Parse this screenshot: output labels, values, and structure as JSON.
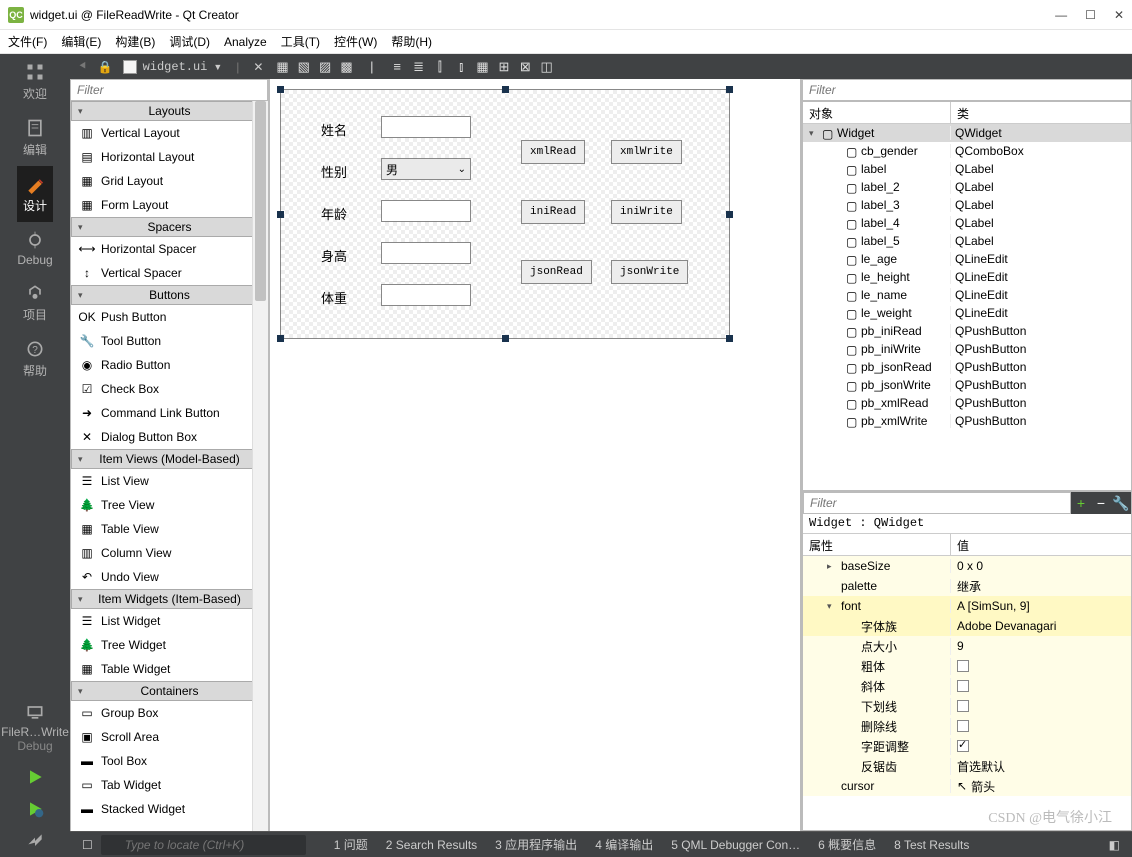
{
  "window": {
    "title": "widget.ui @ FileReadWrite - Qt Creator",
    "logo_text": "QC"
  },
  "menubar": [
    "文件(F)",
    "编辑(E)",
    "构建(B)",
    "调试(D)",
    "Analyze",
    "工具(T)",
    "控件(W)",
    "帮助(H)"
  ],
  "leftbar": {
    "items": [
      {
        "label": "欢迎",
        "active": false
      },
      {
        "label": "编辑",
        "active": false
      },
      {
        "label": "设计",
        "active": true
      },
      {
        "label": "Debug",
        "active": false
      },
      {
        "label": "项目",
        "active": false
      },
      {
        "label": "帮助",
        "active": false
      }
    ],
    "kit_label": "FileR…Write",
    "debug_label": "Debug"
  },
  "filetab": {
    "doc_name": "widget.ui"
  },
  "widgetbox": {
    "filter_placeholder": "Filter",
    "groups": [
      {
        "name": "Layouts",
        "items": [
          "Vertical Layout",
          "Horizontal Layout",
          "Grid Layout",
          "Form Layout"
        ]
      },
      {
        "name": "Spacers",
        "items": [
          "Horizontal Spacer",
          "Vertical Spacer"
        ]
      },
      {
        "name": "Buttons",
        "items": [
          "Push Button",
          "Tool Button",
          "Radio Button",
          "Check Box",
          "Command Link Button",
          "Dialog Button Box"
        ]
      },
      {
        "name": "Item Views (Model-Based)",
        "items": [
          "List View",
          "Tree View",
          "Table View",
          "Column View",
          "Undo View"
        ]
      },
      {
        "name": "Item Widgets (Item-Based)",
        "items": [
          "List Widget",
          "Tree Widget",
          "Table Widget"
        ]
      },
      {
        "name": "Containers",
        "items": [
          "Group Box",
          "Scroll Area",
          "Tool Box",
          "Tab Widget",
          "Stacked Widget"
        ]
      }
    ]
  },
  "form": {
    "labels": {
      "name": "姓名",
      "gender": "性别",
      "age": "年龄",
      "height": "身高",
      "weight": "体重"
    },
    "combo_value": "男",
    "buttons": {
      "xmlRead": "xmlRead",
      "xmlWrite": "xmlWrite",
      "iniRead": "iniRead",
      "iniWrite": "iniWrite",
      "jsonRead": "jsonRead",
      "jsonWrite": "jsonWrite"
    }
  },
  "object_tree": {
    "filter_placeholder": "Filter",
    "col_object": "对象",
    "col_class": "类",
    "rows": [
      {
        "indent": 0,
        "name": "Widget",
        "class": "QWidget",
        "expand": "▾",
        "top": true
      },
      {
        "indent": 1,
        "name": "cb_gender",
        "class": "QComboBox"
      },
      {
        "indent": 1,
        "name": "label",
        "class": "QLabel"
      },
      {
        "indent": 1,
        "name": "label_2",
        "class": "QLabel"
      },
      {
        "indent": 1,
        "name": "label_3",
        "class": "QLabel"
      },
      {
        "indent": 1,
        "name": "label_4",
        "class": "QLabel"
      },
      {
        "indent": 1,
        "name": "label_5",
        "class": "QLabel"
      },
      {
        "indent": 1,
        "name": "le_age",
        "class": "QLineEdit"
      },
      {
        "indent": 1,
        "name": "le_height",
        "class": "QLineEdit"
      },
      {
        "indent": 1,
        "name": "le_name",
        "class": "QLineEdit"
      },
      {
        "indent": 1,
        "name": "le_weight",
        "class": "QLineEdit"
      },
      {
        "indent": 1,
        "name": "pb_iniRead",
        "class": "QPushButton"
      },
      {
        "indent": 1,
        "name": "pb_iniWrite",
        "class": "QPushButton"
      },
      {
        "indent": 1,
        "name": "pb_jsonRead",
        "class": "QPushButton"
      },
      {
        "indent": 1,
        "name": "pb_jsonWrite",
        "class": "QPushButton"
      },
      {
        "indent": 1,
        "name": "pb_xmlRead",
        "class": "QPushButton"
      },
      {
        "indent": 1,
        "name": "pb_xmlWrite",
        "class": "QPushButton"
      }
    ]
  },
  "property_editor": {
    "filter_placeholder": "Filter",
    "breadcrumb": "Widget : QWidget",
    "col_name": "属性",
    "col_value": "值",
    "rows": [
      {
        "name": "baseSize",
        "value": "0 x 0",
        "indent": 1,
        "expand": "▸"
      },
      {
        "name": "palette",
        "value": "继承",
        "indent": 1
      },
      {
        "name": "font",
        "value": "A  [SimSun, 9]",
        "indent": 1,
        "expand": "▾",
        "changed": true
      },
      {
        "name": "字体族",
        "value": "Adobe Devanagari",
        "indent": 2,
        "changed": true
      },
      {
        "name": "点大小",
        "value": "9",
        "indent": 2
      },
      {
        "name": "粗体",
        "value_check": false,
        "indent": 2
      },
      {
        "name": "斜体",
        "value_check": false,
        "indent": 2
      },
      {
        "name": "下划线",
        "value_check": false,
        "indent": 2
      },
      {
        "name": "删除线",
        "value_check": false,
        "indent": 2
      },
      {
        "name": "字距调整",
        "value_check": true,
        "indent": 2
      },
      {
        "name": "反锯齿",
        "value": "首选默认",
        "indent": 2
      },
      {
        "name": "cursor",
        "value": "箭头",
        "indent": 1,
        "icon": "↖"
      }
    ]
  },
  "statusbar": {
    "items": [
      "1  问题",
      "2  Search Results",
      "3  应用程序输出",
      "4  编译输出",
      "5  QML Debugger Con…",
      "6  概要信息",
      "8  Test Results"
    ]
  },
  "locator_placeholder": "Type to locate (Ctrl+K)",
  "watermark": "CSDN @电气徐小江"
}
